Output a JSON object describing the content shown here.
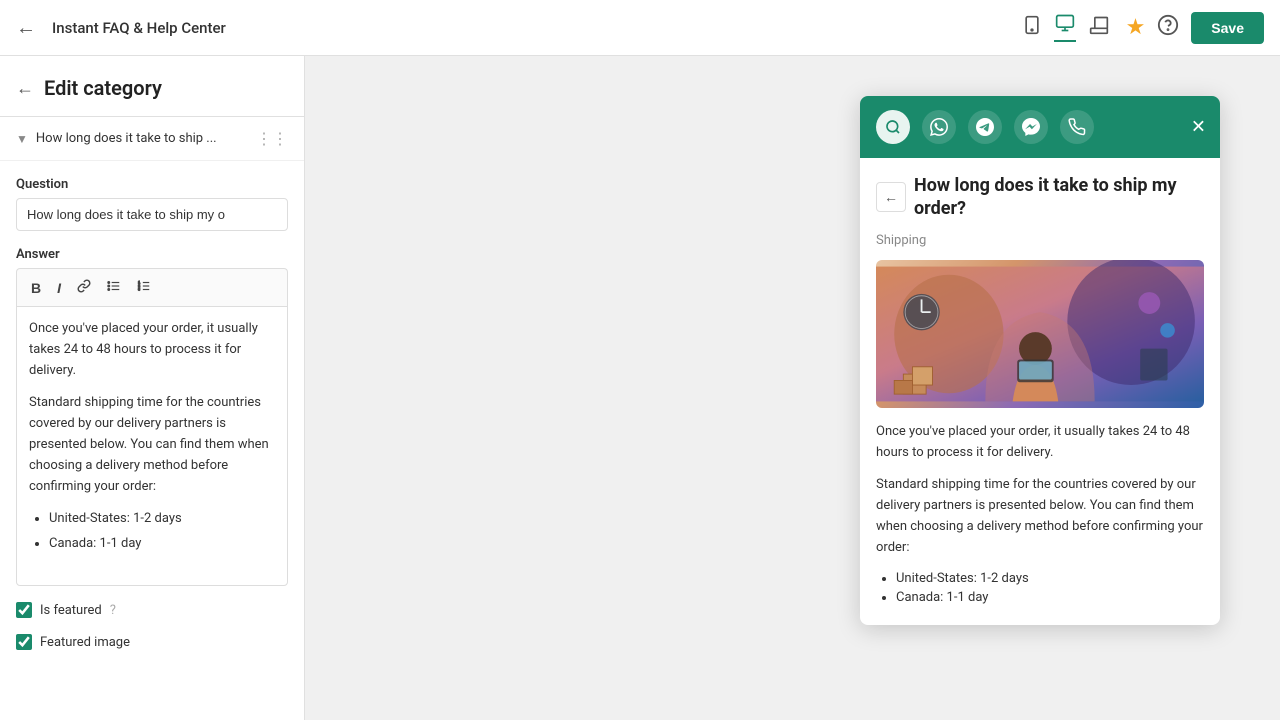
{
  "topbar": {
    "back_icon": "←",
    "title": "Instant FAQ & Help Center",
    "device_icons": [
      "tablet",
      "monitor",
      "arrows"
    ],
    "star_icon": "★",
    "help_icon": "?",
    "save_label": "Save"
  },
  "sidebar": {
    "back_icon": "←",
    "title": "Edit category",
    "category": {
      "label": "How long does it take to ship ...",
      "full_label": "How long does it take to ship my order?"
    }
  },
  "form": {
    "question_label": "Question",
    "question_value": "How long does it take to ship my o",
    "answer_label": "Answer",
    "toolbar": {
      "bold": "B",
      "italic": "I",
      "link": "🔗",
      "bullet": "≡",
      "numbered": "≣"
    },
    "answer_para1": "Once you've placed your order, it usually takes 24 to 48 hours to process it for delivery.",
    "answer_para2": "Standard shipping time for the countries covered by our delivery partners is presented below. You can find them when choosing a delivery method before confirming your order:",
    "answer_list": [
      "United-States: 1-2 days",
      "Canada: 1-1 day"
    ],
    "is_featured_label": "Is featured",
    "featured_image_label": "Featured image",
    "info_icon": "?"
  },
  "widget": {
    "close_icon": "✕",
    "back_icon": "←",
    "channels": [
      "search",
      "whatsapp",
      "telegram",
      "messenger",
      "phone"
    ],
    "question_title": "How long does it take to ship my order?",
    "category_tag": "Shipping",
    "content_para1": "Once you've placed your order, it usually takes 24 to 48 hours to process it for delivery.",
    "content_para2": "Standard shipping time for the countries covered by our delivery partners is presented below. You can find them when choosing a delivery method before confirming your order:",
    "content_list": [
      "United-States: 1-2 days",
      "Canada: 1-1 day"
    ]
  }
}
